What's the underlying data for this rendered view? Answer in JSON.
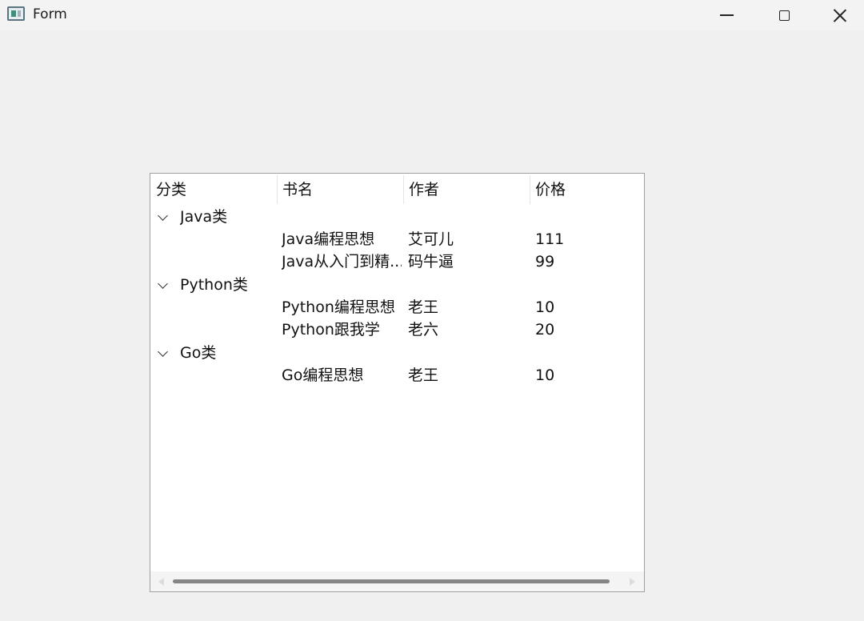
{
  "window": {
    "title": "Form",
    "icon": "form-app-icon",
    "controls": {
      "minimize_icon": "minimize-icon",
      "maximize_icon": "maximize-icon",
      "close_icon": "close-icon"
    }
  },
  "tree": {
    "headers": [
      "分类",
      "书名",
      "作者",
      "价格"
    ],
    "groups": [
      {
        "category": "Java类",
        "expanded": true,
        "books": [
          {
            "title": "Java编程思想",
            "author": "艾可儿",
            "price": "111"
          },
          {
            "title": "Java从入门到精...",
            "author": "码牛逼",
            "price": "99"
          }
        ]
      },
      {
        "category": "Python类",
        "expanded": true,
        "books": [
          {
            "title": "Python编程思想",
            "author": "老王",
            "price": "10"
          },
          {
            "title": "Python跟我学",
            "author": "老六",
            "price": "20"
          }
        ]
      },
      {
        "category": "Go类",
        "expanded": true,
        "books": [
          {
            "title": "Go编程思想",
            "author": "老王",
            "price": "10"
          }
        ]
      }
    ]
  },
  "colors": {
    "window_bg": "#f0f0f0",
    "tree_bg": "#ffffff",
    "tree_border": "#a0a0a0",
    "scrollbar_thumb": "#858585"
  }
}
